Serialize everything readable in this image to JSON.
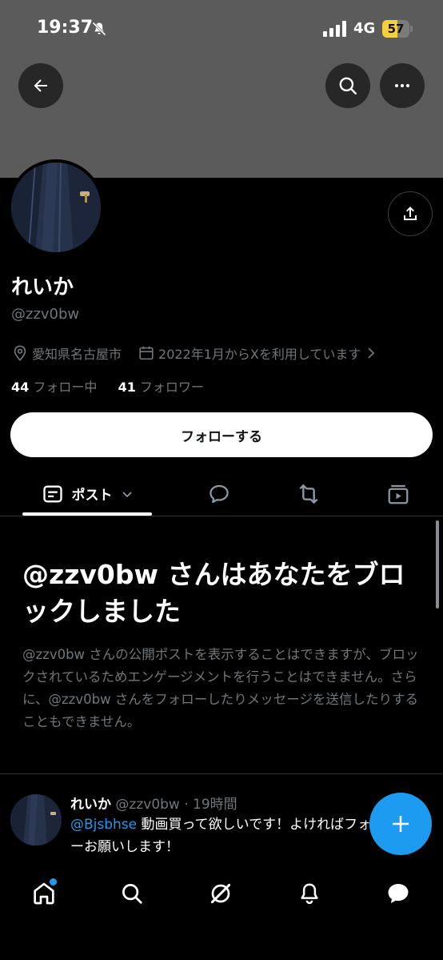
{
  "status_bar": {
    "time": "19:37",
    "network": "4G",
    "battery_level": "57",
    "battery_percent": 57,
    "battery_color": "#f4d03f"
  },
  "header": {
    "back_icon": "arrow-left-icon",
    "search_icon": "search-icon",
    "more_icon": "more-horizontal-icon",
    "banner_color": "#5b5b5b"
  },
  "profile": {
    "name": "れいか",
    "handle": "@zzv0bw",
    "location": "愛知県名古屋市",
    "joined": "2022年1月からXを利用しています",
    "following_count": "44",
    "following_label": "フォロー中",
    "followers_count": "41",
    "followers_label": "フォロワー",
    "follow_button": "フォローする"
  },
  "tabs": {
    "posts_label": "ポスト",
    "icons": [
      "posts-icon",
      "replies-icon",
      "reposts-icon",
      "media-icon"
    ]
  },
  "blocked_notice": {
    "title": "@zzv0bw さんはあなたをブロックしました",
    "description": "@zzv0bw さんの公開ポストを表示することはできますが、ブロックされているためエンゲージメントを行うことはできません。さらに、@zzv0bw さんをフォローしたりメッセージを送信したりすることもできません。"
  },
  "tweet": {
    "name": "れいか",
    "meta": "@zzv0bw · 19時間",
    "mention": "@Bjsbhse",
    "text": " 動画買って欲しいです！よければフォローお願いします！"
  },
  "bottom_nav": {
    "items": [
      "home-icon",
      "search-icon",
      "grok-icon",
      "notifications-icon",
      "messages-icon"
    ],
    "accent": "#1d9bf0"
  }
}
